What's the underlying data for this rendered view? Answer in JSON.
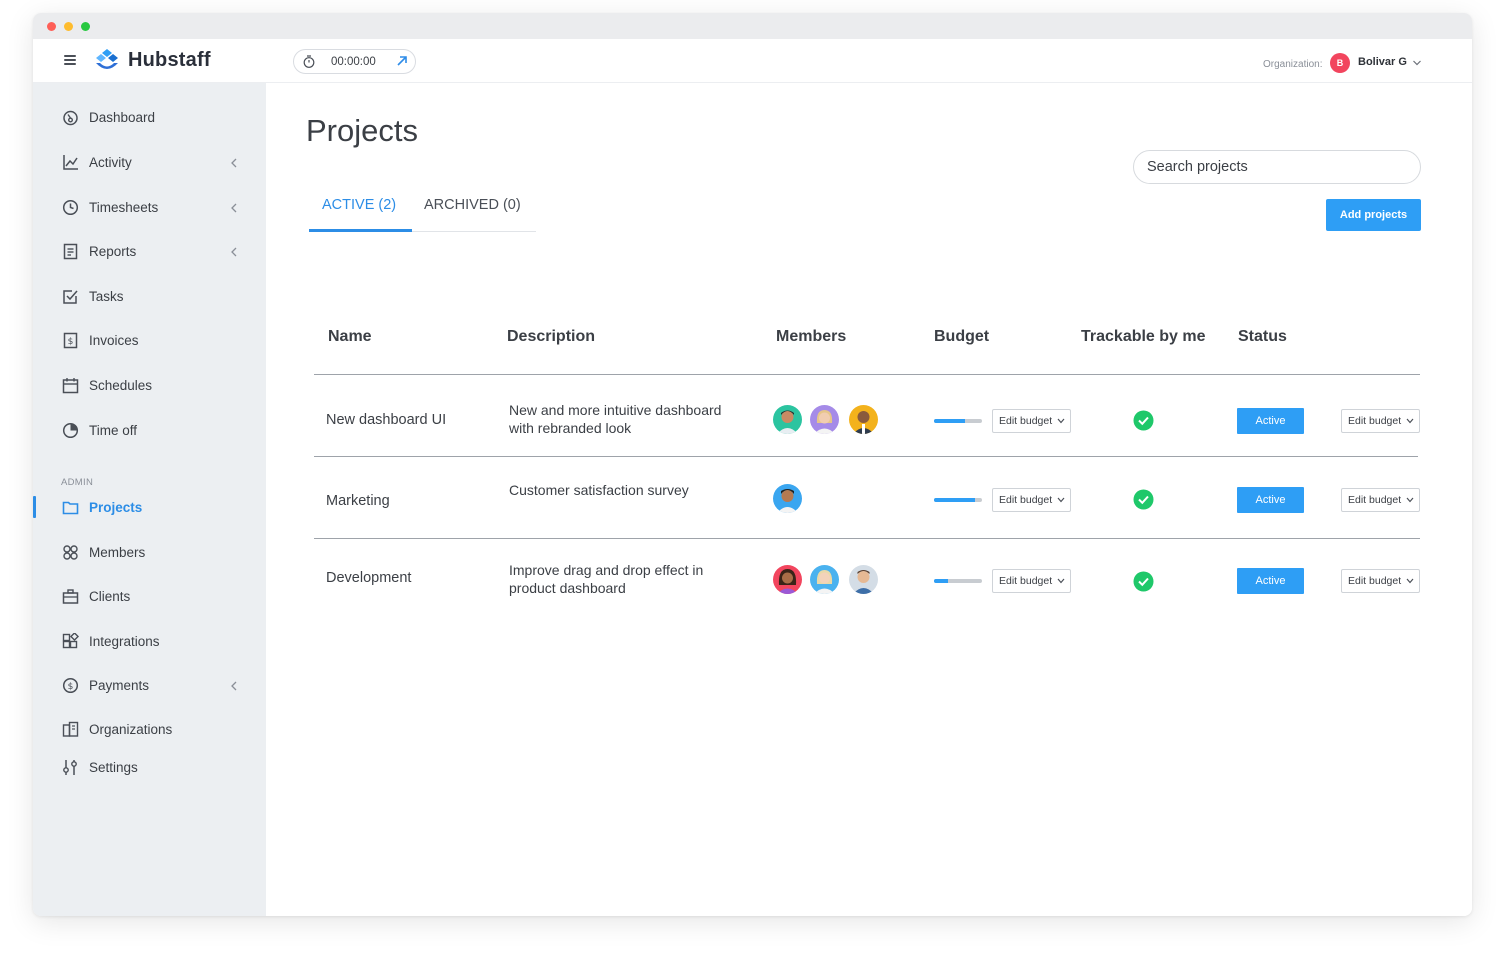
{
  "app": {
    "logo_text": "Hubstaff",
    "timer": "00:00:00",
    "org_label": "Organization:",
    "org_initial": "B",
    "org_name": "Bolivar G"
  },
  "sidebar": {
    "items": [
      {
        "label": "Dashboard",
        "icon": "dashboard-icon",
        "has_chevron": false
      },
      {
        "label": "Activity",
        "icon": "activity-icon",
        "has_chevron": true
      },
      {
        "label": "Timesheets",
        "icon": "clock-icon",
        "has_chevron": true
      },
      {
        "label": "Reports",
        "icon": "report-icon",
        "has_chevron": true
      },
      {
        "label": "Tasks",
        "icon": "checkbox-icon",
        "has_chevron": false
      },
      {
        "label": "Invoices",
        "icon": "invoice-icon",
        "has_chevron": false
      },
      {
        "label": "Schedules",
        "icon": "calendar-icon",
        "has_chevron": false
      },
      {
        "label": "Time off",
        "icon": "pie-icon",
        "has_chevron": false
      }
    ],
    "admin_label": "ADMIN",
    "admin_items": [
      {
        "label": "Projects",
        "icon": "folder-icon",
        "active": true
      },
      {
        "label": "Members",
        "icon": "members-icon",
        "active": false
      },
      {
        "label": "Clients",
        "icon": "briefcase-icon",
        "active": false
      },
      {
        "label": "Integrations",
        "icon": "integrations-icon",
        "active": false
      },
      {
        "label": "Payments",
        "icon": "dollar-icon",
        "active": false,
        "has_chevron": true
      },
      {
        "label": "Organizations",
        "icon": "organization-icon",
        "active": false
      },
      {
        "label": "Settings",
        "icon": "sliders-icon",
        "active": false
      }
    ]
  },
  "main": {
    "title": "Projects",
    "tabs": [
      {
        "label": "ACTIVE (2)",
        "active": true
      },
      {
        "label": "ARCHIVED (0)",
        "active": false
      }
    ],
    "search_placeholder": "Search projects",
    "add_button": "Add projects",
    "columns": [
      "Name",
      "Description",
      "Members",
      "Budget",
      "Trackable by me",
      "Status"
    ],
    "rows": [
      {
        "name": "New dashboard UI",
        "description": "New and more intuitive dashboard with rebranded look",
        "member_count": 3,
        "budget_progress": 0.65,
        "edit_budget": "Edit budget",
        "trackable": true,
        "status": "Active",
        "action": "Edit budget"
      },
      {
        "name": "Marketing",
        "description": "Customer satisfaction survey",
        "member_count": 1,
        "budget_progress": 0.85,
        "edit_budget": "Edit budget",
        "trackable": true,
        "status": "Active",
        "action": "Edit budget"
      },
      {
        "name": "Development",
        "description": "Improve drag and drop effect in product dashboard",
        "member_count": 3,
        "budget_progress": 0.3,
        "edit_budget": "Edit budget",
        "trackable": true,
        "status": "Active",
        "action": "Edit budget"
      }
    ]
  },
  "colors": {
    "accent": "#2e9ef5",
    "active_nav": "#2c8de6",
    "check": "#1fc86a",
    "sidebar_bg": "#eceff2",
    "org_avatar": "#f2455e"
  }
}
